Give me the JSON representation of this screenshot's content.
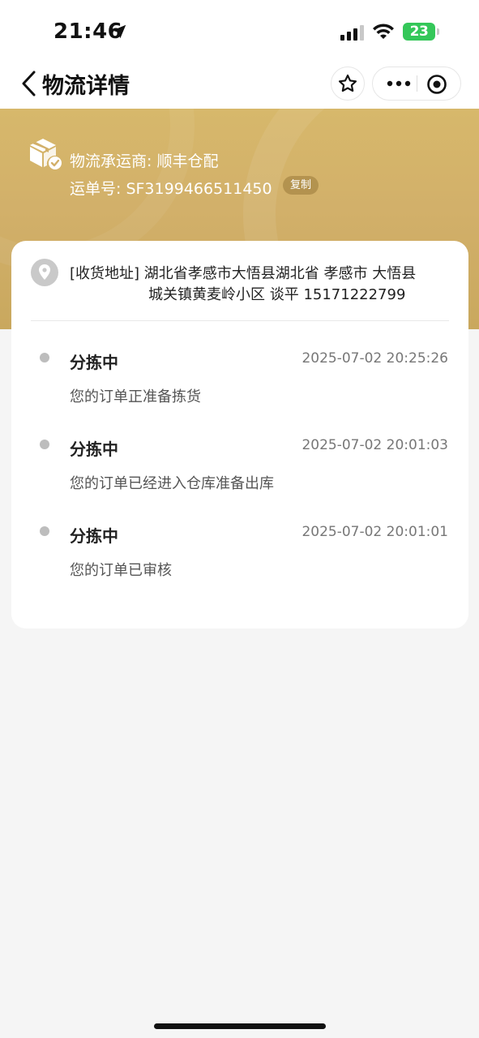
{
  "status_bar": {
    "time": "21:46",
    "battery": "23"
  },
  "nav": {
    "title": "物流详情",
    "icons": {
      "back": "chevron-left-icon",
      "favorite": "star-icon",
      "more": "more-dots-icon",
      "close": "target-circle-icon"
    }
  },
  "banner": {
    "carrier_label": "物流承运商: 顺丰仓配",
    "waybill_label": "运单号: SF3199466511450",
    "copy_label": "复制"
  },
  "address": {
    "line1": "[收货地址] 湖北省孝感市大悟县湖北省 孝感市 大悟县",
    "line2": "城关镇黄麦岭小区 谈平 15171222799"
  },
  "tracking": [
    {
      "status": "分拣中",
      "time": "2025-07-02 20:25:26",
      "desc": "您的订单正准备拣货"
    },
    {
      "status": "分拣中",
      "time": "2025-07-02 20:01:03",
      "desc": "您的订单已经进入仓库准备出库"
    },
    {
      "status": "分拣中",
      "time": "2025-07-02 20:01:01",
      "desc": "您的订单已审核"
    }
  ],
  "colors": {
    "banner_gold": "#d2b06a",
    "battery_green": "#34c759",
    "dot_gray": "#bdbdbd"
  }
}
